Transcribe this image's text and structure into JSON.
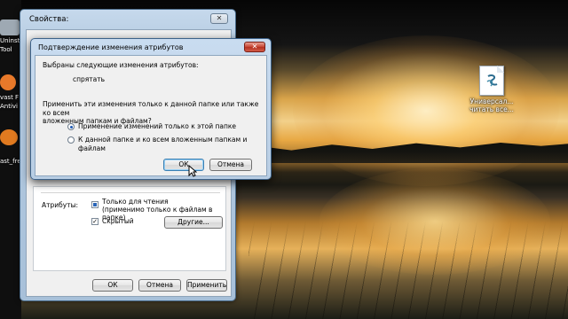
{
  "desktop": {
    "left_icons": [
      {
        "label": "Uninst",
        "sublabel": "Tool",
        "color": "#b8c3cc"
      },
      {
        "label": "vast F",
        "sublabel": "Antivi",
        "color": "#e8792a"
      },
      {
        "label": "",
        "sublabel": "",
        "color": "#e07a20"
      },
      {
        "label": "ast_fre",
        "sublabel": "",
        "color": "#d7d7d7"
      }
    ],
    "file_icon": {
      "name": "document-icon",
      "label_line1": "Универсал...",
      "label_line2": "читать все..."
    }
  },
  "properties_window": {
    "title": "Свойства:",
    "close_symbol": "✕",
    "attributes_label": "Атрибуты:",
    "readonly_label_line1": "Только для чтения",
    "readonly_label_line2": "(применимо только к файлам в папке)",
    "hidden_label": "Скрытый",
    "hidden_checked": true,
    "other_button": "Другие...",
    "buttons": {
      "ok": "ОК",
      "cancel": "Отмена",
      "apply": "Применить"
    }
  },
  "confirm_dialog": {
    "title": "Подтверждение изменения атрибутов",
    "close_symbol": "✕",
    "selected_changes_text": "Выбраны следующие изменения атрибутов:",
    "change_item": "спрятать",
    "question_line1": "Применить эти изменения только к данной папке или также ко всем",
    "question_line2": "вложенным папкам и файлам?",
    "option1": "Применение изменений только к этой папке",
    "option2": "К данной папке и ко всем вложенным папкам и файлам",
    "selected_option": 1,
    "ok_button": "ОК",
    "cancel_button": "Отмена"
  },
  "colors": {
    "accent": "#3c7fb1",
    "close_red": "#c64331",
    "title_bar": "#b8cde3"
  }
}
